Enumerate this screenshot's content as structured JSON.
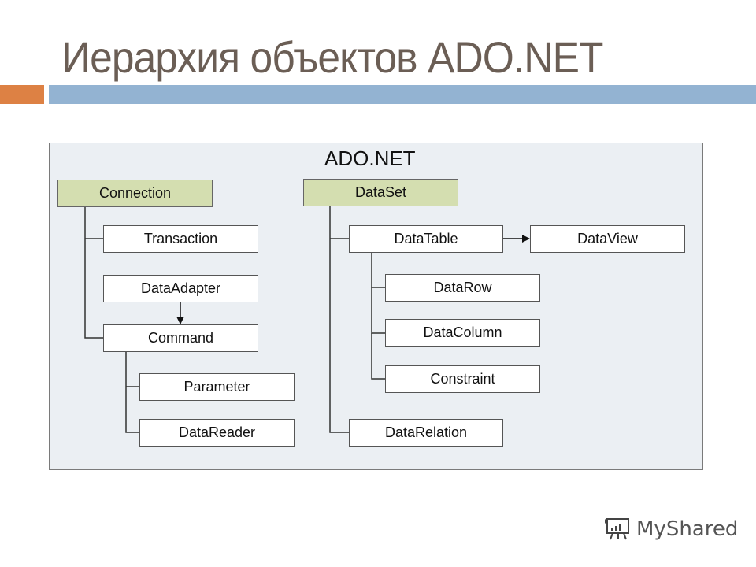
{
  "slide": {
    "title": "Иерархия объектов ADO.NET",
    "accent_colors": {
      "orange": "#dd8144",
      "blue": "#93b3d2",
      "root_fill": "#d4deb0",
      "frame_fill": "#ebeff3"
    }
  },
  "diagram": {
    "frame_title": "ADO.NET",
    "nodes": {
      "connection": "Connection",
      "transaction": "Transaction",
      "dataadapter": "DataAdapter",
      "command": "Command",
      "parameter": "Parameter",
      "datareader": "DataReader",
      "dataset": "DataSet",
      "datatable": "DataTable",
      "dataview": "DataView",
      "datarow": "DataRow",
      "datacolumn": "DataColumn",
      "constraint": "Constraint",
      "datarelation": "DataRelation"
    },
    "edges": [
      {
        "from": "Connection",
        "to": "Transaction",
        "type": "tree"
      },
      {
        "from": "Connection",
        "to": "Command",
        "type": "tree"
      },
      {
        "from": "DataAdapter",
        "to": "Command",
        "type": "arrow"
      },
      {
        "from": "Command",
        "to": "Parameter",
        "type": "tree"
      },
      {
        "from": "Command",
        "to": "DataReader",
        "type": "tree"
      },
      {
        "from": "DataSet",
        "to": "DataTable",
        "type": "tree"
      },
      {
        "from": "DataSet",
        "to": "DataRelation",
        "type": "tree"
      },
      {
        "from": "DataTable",
        "to": "DataView",
        "type": "arrow"
      },
      {
        "from": "DataTable",
        "to": "DataRow",
        "type": "tree"
      },
      {
        "from": "DataTable",
        "to": "DataColumn",
        "type": "tree"
      },
      {
        "from": "DataTable",
        "to": "Constraint",
        "type": "tree"
      }
    ]
  },
  "watermark": {
    "text": "MyShared",
    "icon": "presentation-board-icon"
  }
}
